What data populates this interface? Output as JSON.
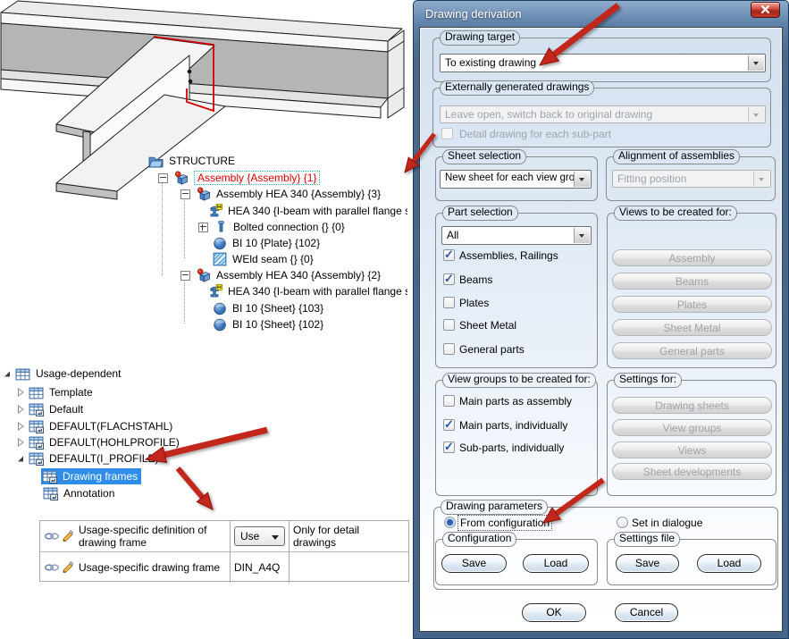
{
  "colors": {
    "arrow_red": "#c3271b",
    "selection_blue": "#2e8de8",
    "tree_selected_text": "#e00000",
    "titlebar_blue": "#49688c"
  },
  "structure_tree": {
    "items": [
      {
        "label": "STRUCTURE",
        "icon": "folder-open-icon"
      },
      {
        "label": "Assembly {Assembly} {1}",
        "icon": "assembly-icon",
        "expand": "minus",
        "selected": true
      },
      {
        "label": "Assembly HEA 340 {Assembly} {3}",
        "icon": "assembly-icon",
        "expand": "minus"
      },
      {
        "label": "HEA 340 {I-beam with parallel flange s",
        "icon": "beam-icon"
      },
      {
        "label": "Bolted connection {} {0}",
        "icon": "bolt-icon",
        "expand": "plus"
      },
      {
        "label": "BI 10 {Plate} {102}",
        "icon": "plate-icon"
      },
      {
        "label": "WEld seam {} {0}",
        "icon": "weld-icon"
      },
      {
        "label": "Assembly HEA 340 {Assembly} {2}",
        "icon": "assembly-icon",
        "expand": "minus"
      },
      {
        "label": "HEA 340 {I-beam with parallel flange s",
        "icon": "beam-icon"
      },
      {
        "label": "BI 10 {Sheet} {103}",
        "icon": "plate-icon"
      },
      {
        "label": "BI 10 {Sheet} {102}",
        "icon": "plate-icon"
      }
    ]
  },
  "config_tree": {
    "items": [
      {
        "label": "Usage-dependent",
        "icon": "table-icon",
        "expanded": true
      },
      {
        "label": "Template",
        "icon": "table-icon",
        "expanded": false
      },
      {
        "label": "Default",
        "icon": "table-link-icon",
        "expanded": false
      },
      {
        "label": "DEFAULT(FLACHSTAHL)",
        "icon": "table-link-icon",
        "expanded": false
      },
      {
        "label": "DEFAULT(HOHLPROFILE)",
        "icon": "table-link-icon",
        "expanded": false
      },
      {
        "label": "DEFAULT(I_PROFILE)",
        "icon": "table-link-icon",
        "expanded": true
      },
      {
        "label": "Drawing frames",
        "icon": "table-link-icon",
        "selected": true
      },
      {
        "label": "Annotation",
        "icon": "table-link-icon"
      }
    ]
  },
  "properties_table": {
    "rows": [
      {
        "label": "Usage-specific definition of drawing frame",
        "value": "Use",
        "value_type": "dropdown",
        "comment": "Only for detail drawings"
      },
      {
        "label": "Usage-specific drawing frame",
        "value": "DIN_A4Q",
        "value_type": "text",
        "comment": ""
      }
    ]
  },
  "dialog": {
    "title": "Drawing derivation",
    "drawing_target": {
      "label": "Drawing target",
      "value": "To existing drawing"
    },
    "externally_generated": {
      "label": "Externally generated drawings",
      "value": "Leave open, switch back to original drawing",
      "checkbox": "Detail drawing for each sub-part",
      "checkbox_checked": false
    },
    "sheet_selection": {
      "label": "Sheet selection",
      "value": "New sheet for each view group"
    },
    "alignment": {
      "label": "Alignment of assemblies",
      "value": "Fitting position"
    },
    "part_selection": {
      "label": "Part selection",
      "value": "All",
      "options": [
        {
          "label": "Assemblies, Railings",
          "checked": true
        },
        {
          "label": "Beams",
          "checked": true
        },
        {
          "label": "Plates",
          "checked": false
        },
        {
          "label": "Sheet Metal",
          "checked": false
        },
        {
          "label": "General parts",
          "checked": false
        }
      ]
    },
    "views_for": {
      "label": "Views to be created for:",
      "buttons": [
        "Assembly",
        "Beams",
        "Plates",
        "Sheet Metal",
        "General parts"
      ]
    },
    "view_groups": {
      "label": "View groups to be created for:",
      "options": [
        {
          "label": "Main parts as assembly",
          "checked": false
        },
        {
          "label": "Main parts, individually",
          "checked": true
        },
        {
          "label": "Sub-parts, individually",
          "checked": true
        }
      ]
    },
    "settings_for": {
      "label": "Settings for:",
      "buttons": [
        "Drawing sheets",
        "View groups",
        "Views",
        "Sheet developments"
      ]
    },
    "drawing_parameters": {
      "label": "Drawing parameters",
      "radio1": "From configuration",
      "radio1_selected": true,
      "radio2": "Set in dialogue",
      "radio2_selected": false
    },
    "configuration": {
      "label": "Configuration",
      "save": "Save",
      "load": "Load"
    },
    "settings_file": {
      "label": "Settings file",
      "save": "Save",
      "load": "Load"
    },
    "ok": "OK",
    "cancel": "Cancel"
  }
}
